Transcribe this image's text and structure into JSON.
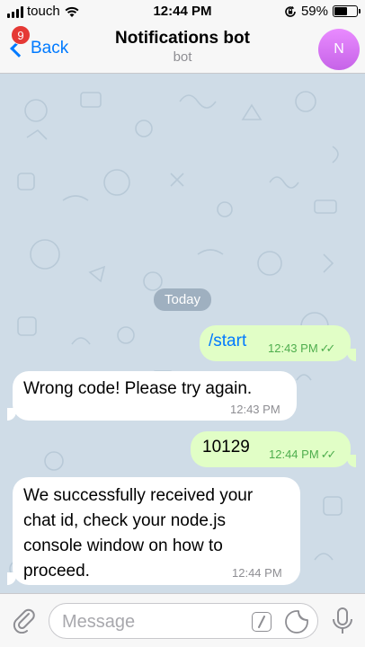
{
  "status_bar": {
    "carrier": "touch",
    "time": "12:44 PM",
    "battery": "59%",
    "battery_level": 0.59
  },
  "nav": {
    "back_label": "Back",
    "unread_badge": "9",
    "title": "Notifications bot",
    "subtitle": "bot",
    "avatar_letter": "N",
    "avatar_color": "#d678f2"
  },
  "chat": {
    "date_divider": "Today",
    "messages": [
      {
        "direction": "out",
        "text": "/start",
        "time": "12:43 PM",
        "status": "read"
      },
      {
        "direction": "in",
        "text": "Wrong code! Please try again.",
        "time": "12:43 PM"
      },
      {
        "direction": "out",
        "text": "10129",
        "time": "12:44 PM",
        "status": "read"
      },
      {
        "direction": "in",
        "lines": [
          "We successfully received your",
          "chat id, check your node.js",
          "console window on how to",
          "proceed."
        ],
        "time": "12:44 PM"
      }
    ]
  },
  "input": {
    "placeholder": "Message",
    "value": ""
  },
  "icons": {
    "attach": "paperclip-icon",
    "commands": "slash-command-icon",
    "sticker": "sticker-icon",
    "voice": "microphone-icon"
  },
  "colors": {
    "accent": "#007aff",
    "outgoing_bubble": "#e1fec6",
    "incoming_bubble": "#ffffff",
    "badge": "#e53935",
    "read_check": "#4fae4e"
  }
}
